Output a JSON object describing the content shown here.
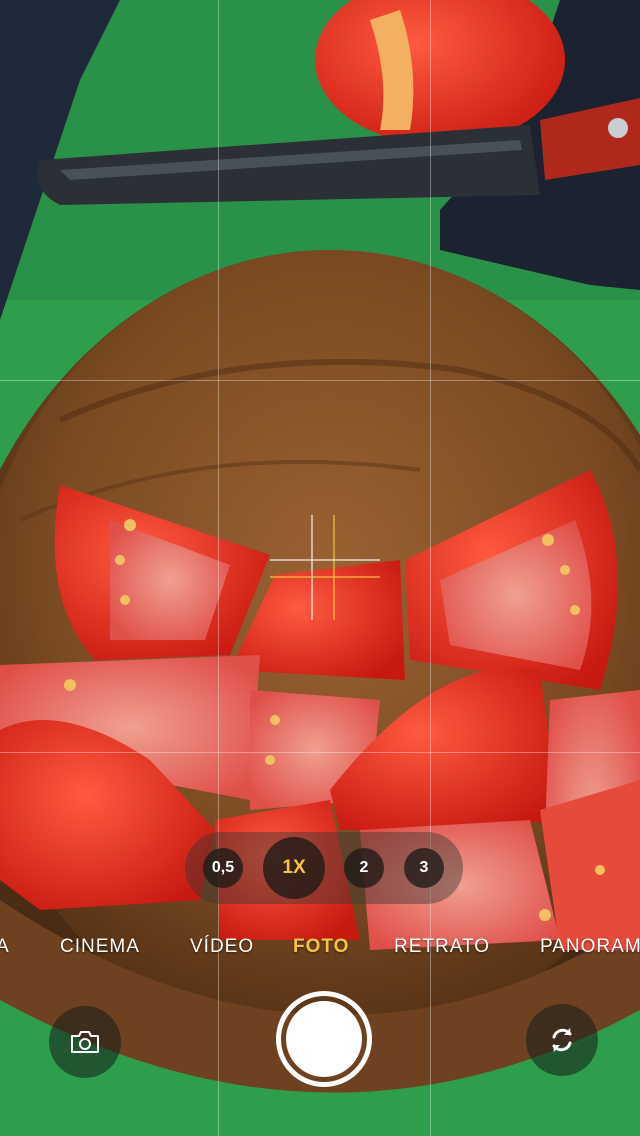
{
  "zoom": {
    "options": [
      "0,5",
      "1X",
      "2",
      "3"
    ],
    "selected": "1X"
  },
  "modes": {
    "items": [
      "A",
      "CINEMA",
      "VÍDEO",
      "FOTO",
      "RETRATO",
      "PANORAM"
    ],
    "active": "FOTO"
  },
  "controls": {
    "gallery_icon": "camera-icon",
    "switch_icon": "switch-camera-icon"
  },
  "colors": {
    "accent": "#f5c542",
    "background_green": "#2f9e4c",
    "bowl_wood": "#8b5a2b",
    "tomato": "#e8261b"
  }
}
